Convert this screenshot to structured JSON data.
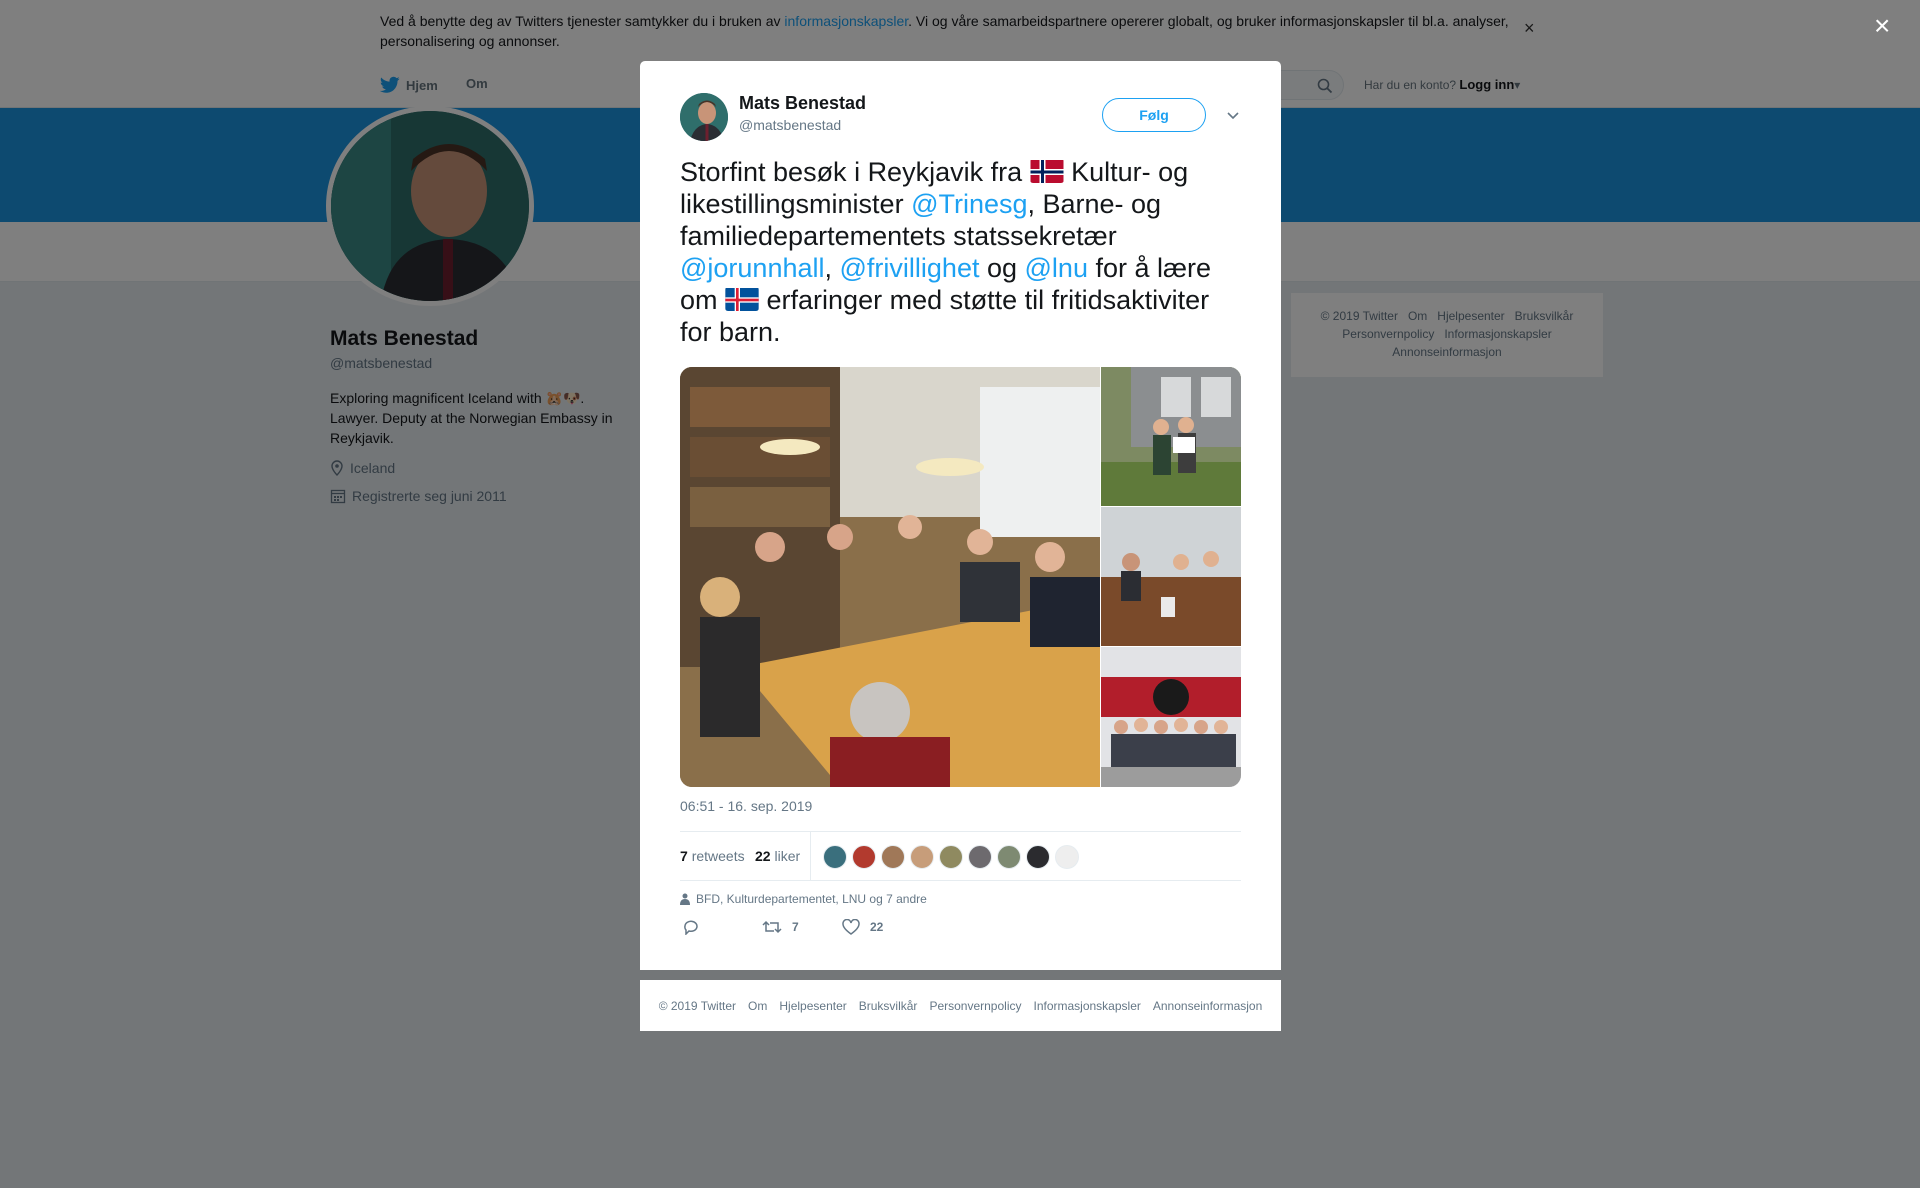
{
  "cookie": {
    "text_before": "Ved å benytte deg av Twitters tjenester samtykker du i bruken av ",
    "link": "informasjonskapsler",
    "text_after": ". Vi og våre samarbeidspartnere opererer globalt, og bruker informasjonskapsler til bl.a. analyser, personalisering og annonser.",
    "close": "×"
  },
  "nav": {
    "home": "Hjem",
    "about": "Om",
    "account_prompt": "Har du en konto?",
    "login": "Logg inn"
  },
  "profile": {
    "name": "Mats Benestad",
    "handle": "@matsbenestad",
    "bio": "Exploring magnificent Iceland with 🐹🐶. Lawyer. Deputy at the Norwegian Embassy in Reykjavik.",
    "location": "Iceland",
    "joined": "Registrerte seg juni 2011"
  },
  "side_footer": {
    "items": [
      "© 2019 Twitter",
      "Om",
      "Hjelpesenter",
      "Bruksvilkår",
      "Personvernpolicy",
      "Informasjonskapsler",
      "Annonseinformasjon"
    ]
  },
  "overlay_close": "×",
  "tweet": {
    "author_name": "Mats Benestad",
    "author_handle": "@matsbenestad",
    "follow_label": "Følg",
    "text": {
      "p1": "Storfint besøk i Reykjavik fra ",
      "p2": " Kultur- og likestillingsminister ",
      "m1": "@Trinesg",
      "p3": ", Barne- og familiedepartementets statssekretær ",
      "m2": "@jorunnhall",
      "p4": ", ",
      "m3": "@frivillighet",
      "p5": " og ",
      "m4": "@lnu",
      "p6": " for å lære om ",
      "p7": " erfaringer med støtte til fritidsaktiviter for barn."
    },
    "timestamp": "06:51 - 16. sep. 2019",
    "retweets_count": "7",
    "retweets_label": "retweets",
    "likes_count": "22",
    "likes_label": "liker",
    "context": "BFD, Kulturdepartementet, LNU og 7 andre",
    "action_retweet_count": "7",
    "action_like_count": "22"
  },
  "bottom_footer": {
    "items": [
      "© 2019 Twitter",
      "Om",
      "Hjelpesenter",
      "Bruksvilkår",
      "Personvernpolicy",
      "Informasjonskapsler",
      "Annonseinformasjon"
    ]
  },
  "colors": {
    "accent": "#1da1f2",
    "banner": "#1b95e0",
    "page_bg": "#e6ecf0"
  }
}
